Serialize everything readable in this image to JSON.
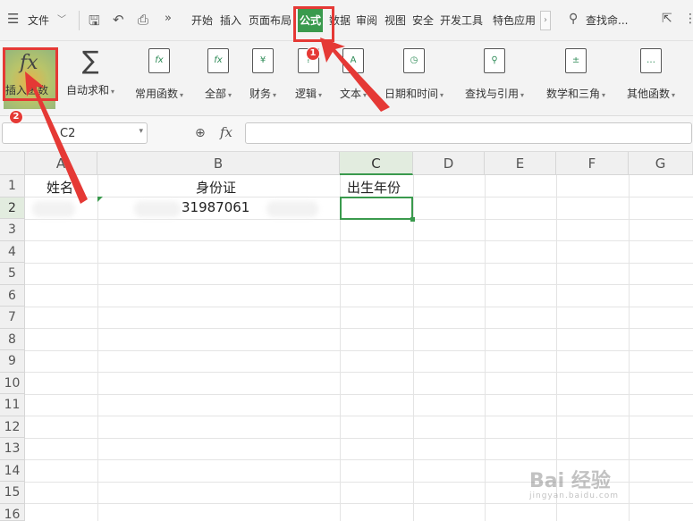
{
  "menubar": {
    "menu_label": "文件",
    "tabs": [
      "开始",
      "插入",
      "页面布局",
      "公式",
      "数据",
      "审阅",
      "视图",
      "安全",
      "开发工具",
      "特色应用"
    ],
    "active_tab": "公式",
    "search_label": "查找命...",
    "accent_color": "#3a9a4d"
  },
  "ribbon": {
    "insert_function": "插入函数",
    "buttons": [
      {
        "label": "自动求和",
        "icon": "sigma-icon"
      },
      {
        "label": "常用函数",
        "icon": "fx-star-icon"
      },
      {
        "label": "全部",
        "icon": "fx-book-icon"
      },
      {
        "label": "财务",
        "icon": "yen-book-icon"
      },
      {
        "label": "逻辑",
        "icon": "logic-book-icon"
      },
      {
        "label": "文本",
        "icon": "text-book-icon"
      },
      {
        "label": "日期和时间",
        "icon": "clock-book-icon"
      },
      {
        "label": "查找与引用",
        "icon": "search-book-icon"
      },
      {
        "label": "数学和三角",
        "icon": "math-book-icon"
      },
      {
        "label": "其他函数",
        "icon": "more-book-icon"
      }
    ]
  },
  "formula_bar": {
    "name_box": "C2",
    "formula": ""
  },
  "sheet": {
    "columns": [
      "A",
      "B",
      "C",
      "D",
      "E",
      "F",
      "G"
    ],
    "selected_column": "C",
    "rows": [
      "1",
      "2",
      "3",
      "4",
      "5",
      "6",
      "7",
      "8",
      "9",
      "10",
      "11",
      "12",
      "13",
      "14",
      "15",
      "16"
    ],
    "selected_row": "2",
    "cells": {
      "A1": "姓名",
      "B1": "身份证",
      "C1": "出生年份",
      "B2": "31987061"
    }
  },
  "annotations": {
    "badge_1": "1",
    "badge_2": "2",
    "highlight_color": "#e53935"
  },
  "watermark": {
    "brand": "Bai 经验",
    "url": "jingyan.baidu.com"
  }
}
